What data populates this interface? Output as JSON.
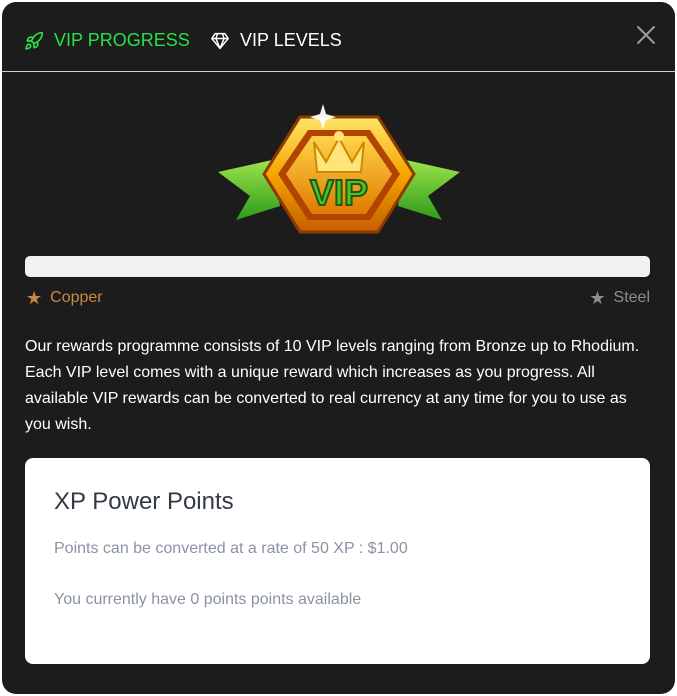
{
  "tabs": [
    {
      "label": "VIP PROGRESS",
      "icon": "rocket-icon",
      "active": true,
      "color": "#27e04a"
    },
    {
      "label": "VIP LEVELS",
      "icon": "diamond-icon",
      "active": false,
      "color": "#ffffff"
    }
  ],
  "badge": {
    "text": "VIP",
    "icon": "vip-badge-icon"
  },
  "progress": {
    "fraction": 0,
    "current_level": "Copper",
    "current_level_color": "#c98a3f",
    "next_level": "Steel",
    "next_level_color": "#8d8d8d"
  },
  "description": "Our rewards programme consists of 10 VIP levels ranging from Bronze up to Rhodium. Each VIP level comes with a unique reward which increases as you progress. All available VIP rewards can be converted to real currency at any time for you to use as you wish.",
  "card": {
    "title": "XP Power Points",
    "rate_text": "Points can be converted at a rate of 50 XP : $1.00",
    "balance_text": "You currently have 0 points points available"
  }
}
